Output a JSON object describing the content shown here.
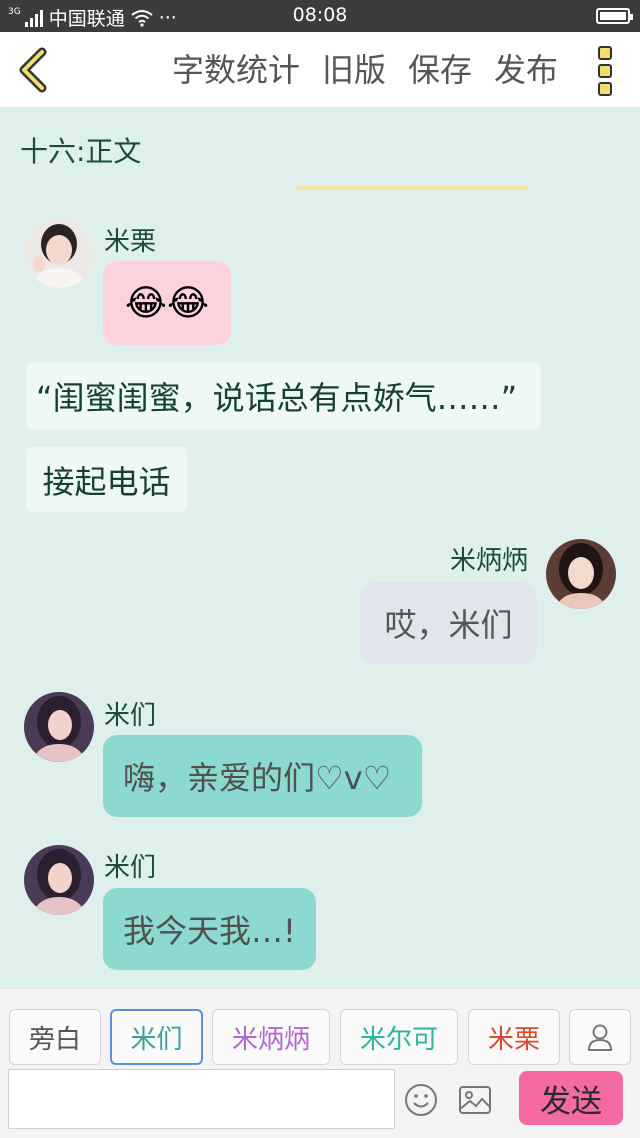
{
  "status_bar": {
    "network": "3G",
    "carrier": "中国联通",
    "extra": "···",
    "time": "08:08"
  },
  "header": {
    "actions": [
      "字数统计",
      "旧版",
      "保存",
      "发布"
    ],
    "back_icon": "chevron-left-icon",
    "more_icon": "more-vertical-icon"
  },
  "chapter": {
    "title": "十六:正文"
  },
  "messages": [
    {
      "type": "chat",
      "sender": "米栗",
      "side": "left",
      "text": "😂😂",
      "bubble_color": "#fcd3dd"
    },
    {
      "type": "narration",
      "text": "“闺蜜闺蜜，说话总有点娇气……”"
    },
    {
      "type": "narration",
      "text": "接起电话"
    },
    {
      "type": "chat",
      "sender": "米炳炳",
      "side": "right",
      "text": "哎，米们",
      "bubble_color": "#e2e6ec"
    },
    {
      "type": "chat",
      "sender": "米们",
      "side": "left",
      "text": "嗨，亲爱的们♡v♡",
      "bubble_color": "#8cd9d0"
    },
    {
      "type": "chat",
      "sender": "米们",
      "side": "left",
      "text": "我今天我…!",
      "bubble_color": "#8cd9d0"
    }
  ],
  "characters": [
    {
      "label": "旁白",
      "color": "#555555"
    },
    {
      "label": "米们",
      "color": "#3aa39a",
      "selected": true
    },
    {
      "label": "米炳炳",
      "color": "#b066d0"
    },
    {
      "label": "米尔可",
      "color": "#2fb39f"
    },
    {
      "label": "米栗",
      "color": "#d94a2e"
    }
  ],
  "composer": {
    "input_value": "",
    "add_character_icon": "user-icon",
    "emoji_icon": "smiley-icon",
    "image_icon": "image-icon",
    "send_label": "发送"
  },
  "colors": {
    "chat_bg": "#dff0ec",
    "send_button": "#f569a4",
    "accent_underline": "#f3e49d"
  }
}
